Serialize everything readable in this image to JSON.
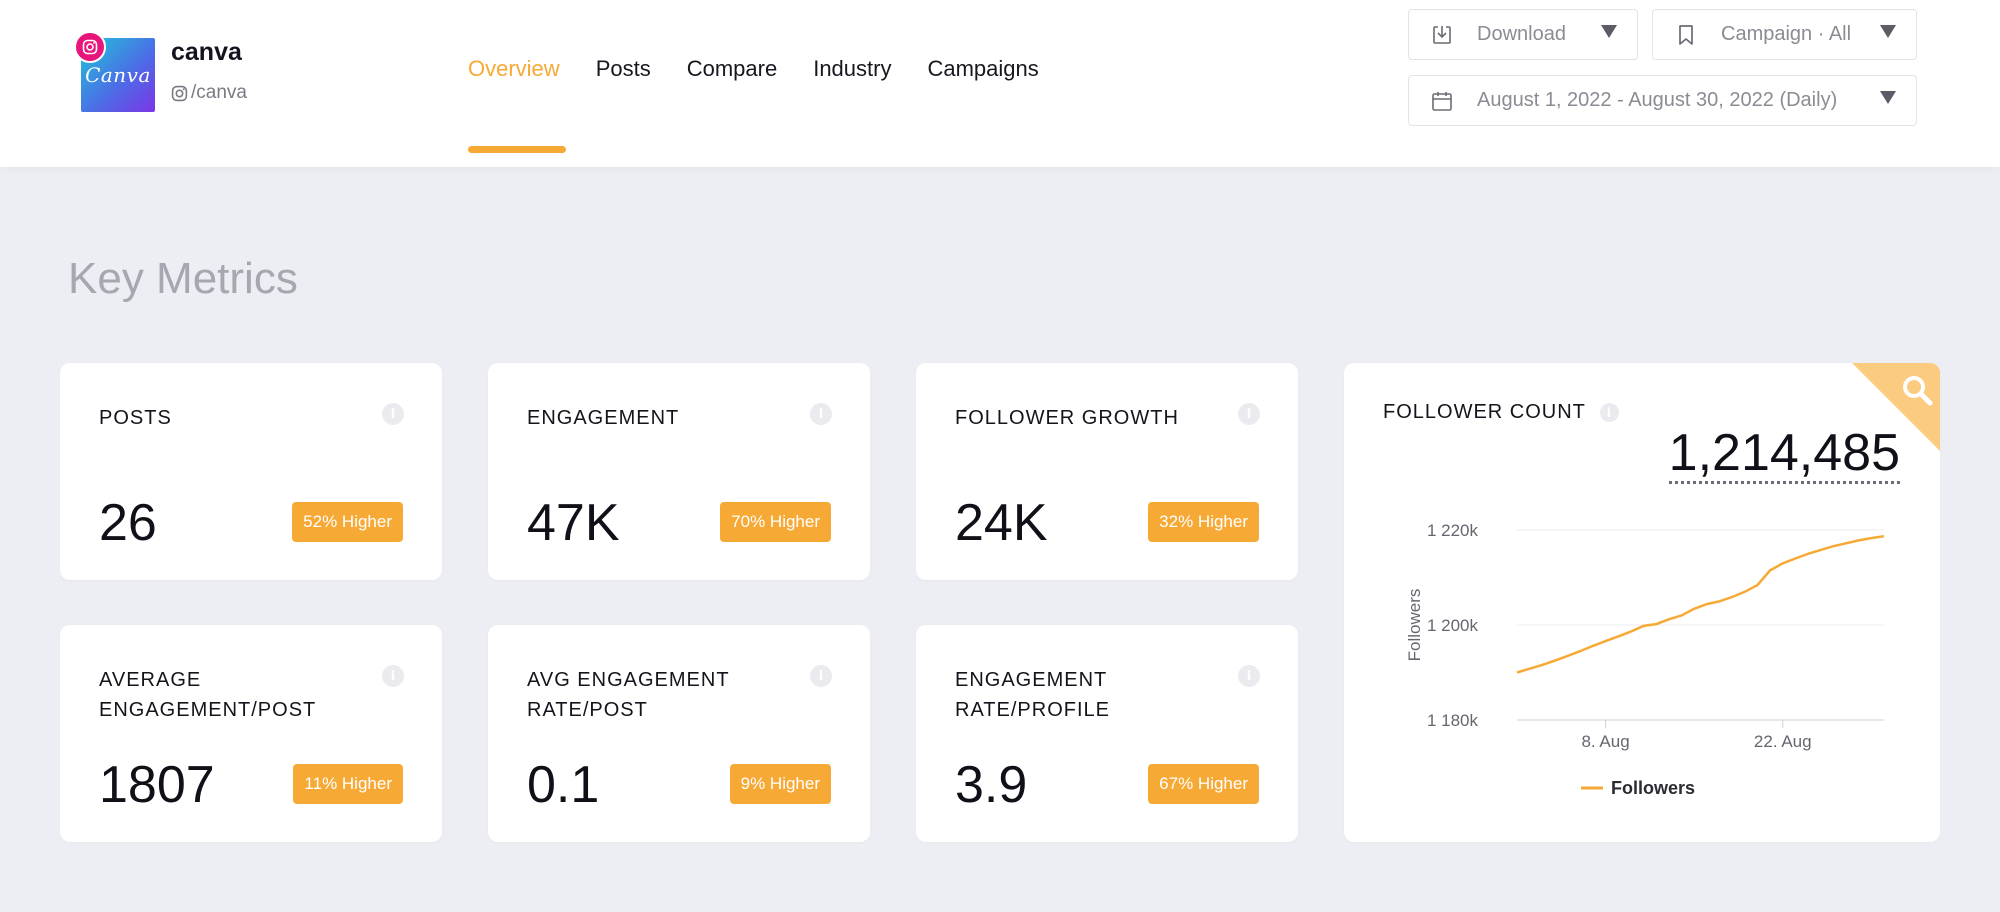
{
  "profile": {
    "name": "canva",
    "handle": "/canva",
    "logo_text": "Canva",
    "platform_icon": "instagram-icon"
  },
  "nav": {
    "items": [
      {
        "label": "Overview",
        "active": true
      },
      {
        "label": "Posts",
        "active": false
      },
      {
        "label": "Compare",
        "active": false
      },
      {
        "label": "Industry",
        "active": false
      },
      {
        "label": "Campaigns",
        "active": false
      }
    ]
  },
  "controls": {
    "download_label": "Download",
    "campaign_label": "Campaign · All",
    "date_range_label": "August 1, 2022 - August 30, 2022 (Daily)"
  },
  "section_title": "Key Metrics",
  "metrics": [
    {
      "title": "POSTS",
      "value": "26",
      "badge": "52% Higher"
    },
    {
      "title": "ENGAGEMENT",
      "value": "47K",
      "badge": "70% Higher"
    },
    {
      "title": "FOLLOWER GROWTH",
      "value": "24K",
      "badge": "32% Higher"
    },
    {
      "title": "AVERAGE ENGAGEMENT/POST",
      "value": "1807",
      "badge": "11% Higher"
    },
    {
      "title": "AVG ENGAGEMENT RATE/POST",
      "value": "0.1",
      "badge": "9% Higher"
    },
    {
      "title": "ENGAGEMENT RATE/PROFILE",
      "value": "3.9",
      "badge": "67% Higher"
    }
  ],
  "follower_card": {
    "title": "FOLLOWER COUNT",
    "value": "1,214,485"
  },
  "chart_data": {
    "type": "line",
    "ylabel": "Followers",
    "y_ticks": [
      "1 180k",
      "1 200k",
      "1 220k"
    ],
    "x_ticks": [
      "8. Aug",
      "22. Aug"
    ],
    "ylim": [
      1180000,
      1220000
    ],
    "grid": true,
    "legend": "bottom-center",
    "color": "#f7a935",
    "series": [
      {
        "name": "Followers",
        "x": [
          "Aug 1",
          "Aug 2",
          "Aug 3",
          "Aug 4",
          "Aug 5",
          "Aug 6",
          "Aug 7",
          "Aug 8",
          "Aug 9",
          "Aug 10",
          "Aug 11",
          "Aug 12",
          "Aug 13",
          "Aug 14",
          "Aug 15",
          "Aug 16",
          "Aug 17",
          "Aug 18",
          "Aug 19",
          "Aug 20",
          "Aug 21",
          "Aug 22",
          "Aug 23",
          "Aug 24",
          "Aug 25",
          "Aug 26",
          "Aug 27",
          "Aug 28",
          "Aug 29",
          "Aug 30"
        ],
        "values": [
          1190000,
          1190800,
          1191600,
          1192500,
          1193500,
          1194500,
          1195600,
          1196600,
          1197600,
          1198600,
          1199800,
          1200200,
          1201200,
          1202000,
          1203400,
          1204400,
          1205000,
          1205900,
          1207000,
          1208400,
          1211500,
          1213000,
          1214000,
          1215000,
          1215800,
          1216600,
          1217200,
          1217800,
          1218300,
          1218700
        ]
      }
    ]
  }
}
